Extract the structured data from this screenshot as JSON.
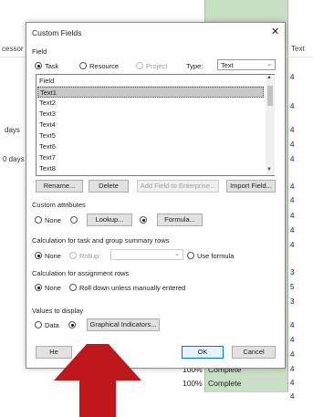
{
  "background": {
    "headers": {
      "col1": "cessor",
      "col2": "Text"
    },
    "rows": [
      {
        "left": "days"
      },
      {
        "left": "0 days"
      }
    ],
    "pct_rows": [
      {
        "pct": "100%",
        "status": "Complete"
      },
      {
        "pct": "100%",
        "status": "Complete"
      }
    ],
    "right_numbers": [
      "4",
      "4",
      "4",
      "4",
      "4",
      "4",
      "4",
      "4",
      "4",
      "4",
      "3",
      "5",
      "3",
      "4",
      "4",
      "4",
      "4",
      "4",
      "4"
    ]
  },
  "dialog": {
    "title": "Custom Fields",
    "close": "✕",
    "field_label": "Field",
    "radio_task": "Task",
    "radio_resource": "Resource",
    "radio_project": "Project",
    "type_label": "Type:",
    "type_value": "Text",
    "list_header": "Field",
    "list_items": [
      "Text1",
      "Text2",
      "Text3",
      "Text4",
      "Text5",
      "Text6",
      "Text7",
      "Text8"
    ],
    "buttons_row1": {
      "rename": "Rename...",
      "delete": "Delete",
      "add_enterprise": "Add Field to Enterprise...",
      "import": "Import Field..."
    },
    "custom_attributes": {
      "label": "Custom attributes",
      "none": "None",
      "lookup": "Lookup...",
      "formula": "Formula..."
    },
    "calc_summary": {
      "label": "Calculation for task and group summary rows",
      "none": "None",
      "rollup": "Rollup:",
      "use_formula": "Use formula"
    },
    "calc_assign": {
      "label": "Calculation for assignment rows",
      "none": "None",
      "rolldown": "Roll down unless manually entered"
    },
    "values_display": {
      "label": "Values to display",
      "data": "Data",
      "graphical": "Graphical Indicators..."
    },
    "help": "He",
    "ok": "OK",
    "cancel": "Cancel"
  },
  "colors": {
    "arrow": "#c0171d",
    "grid_green": "#c9dfc5",
    "ok_border": "#0078d7"
  }
}
